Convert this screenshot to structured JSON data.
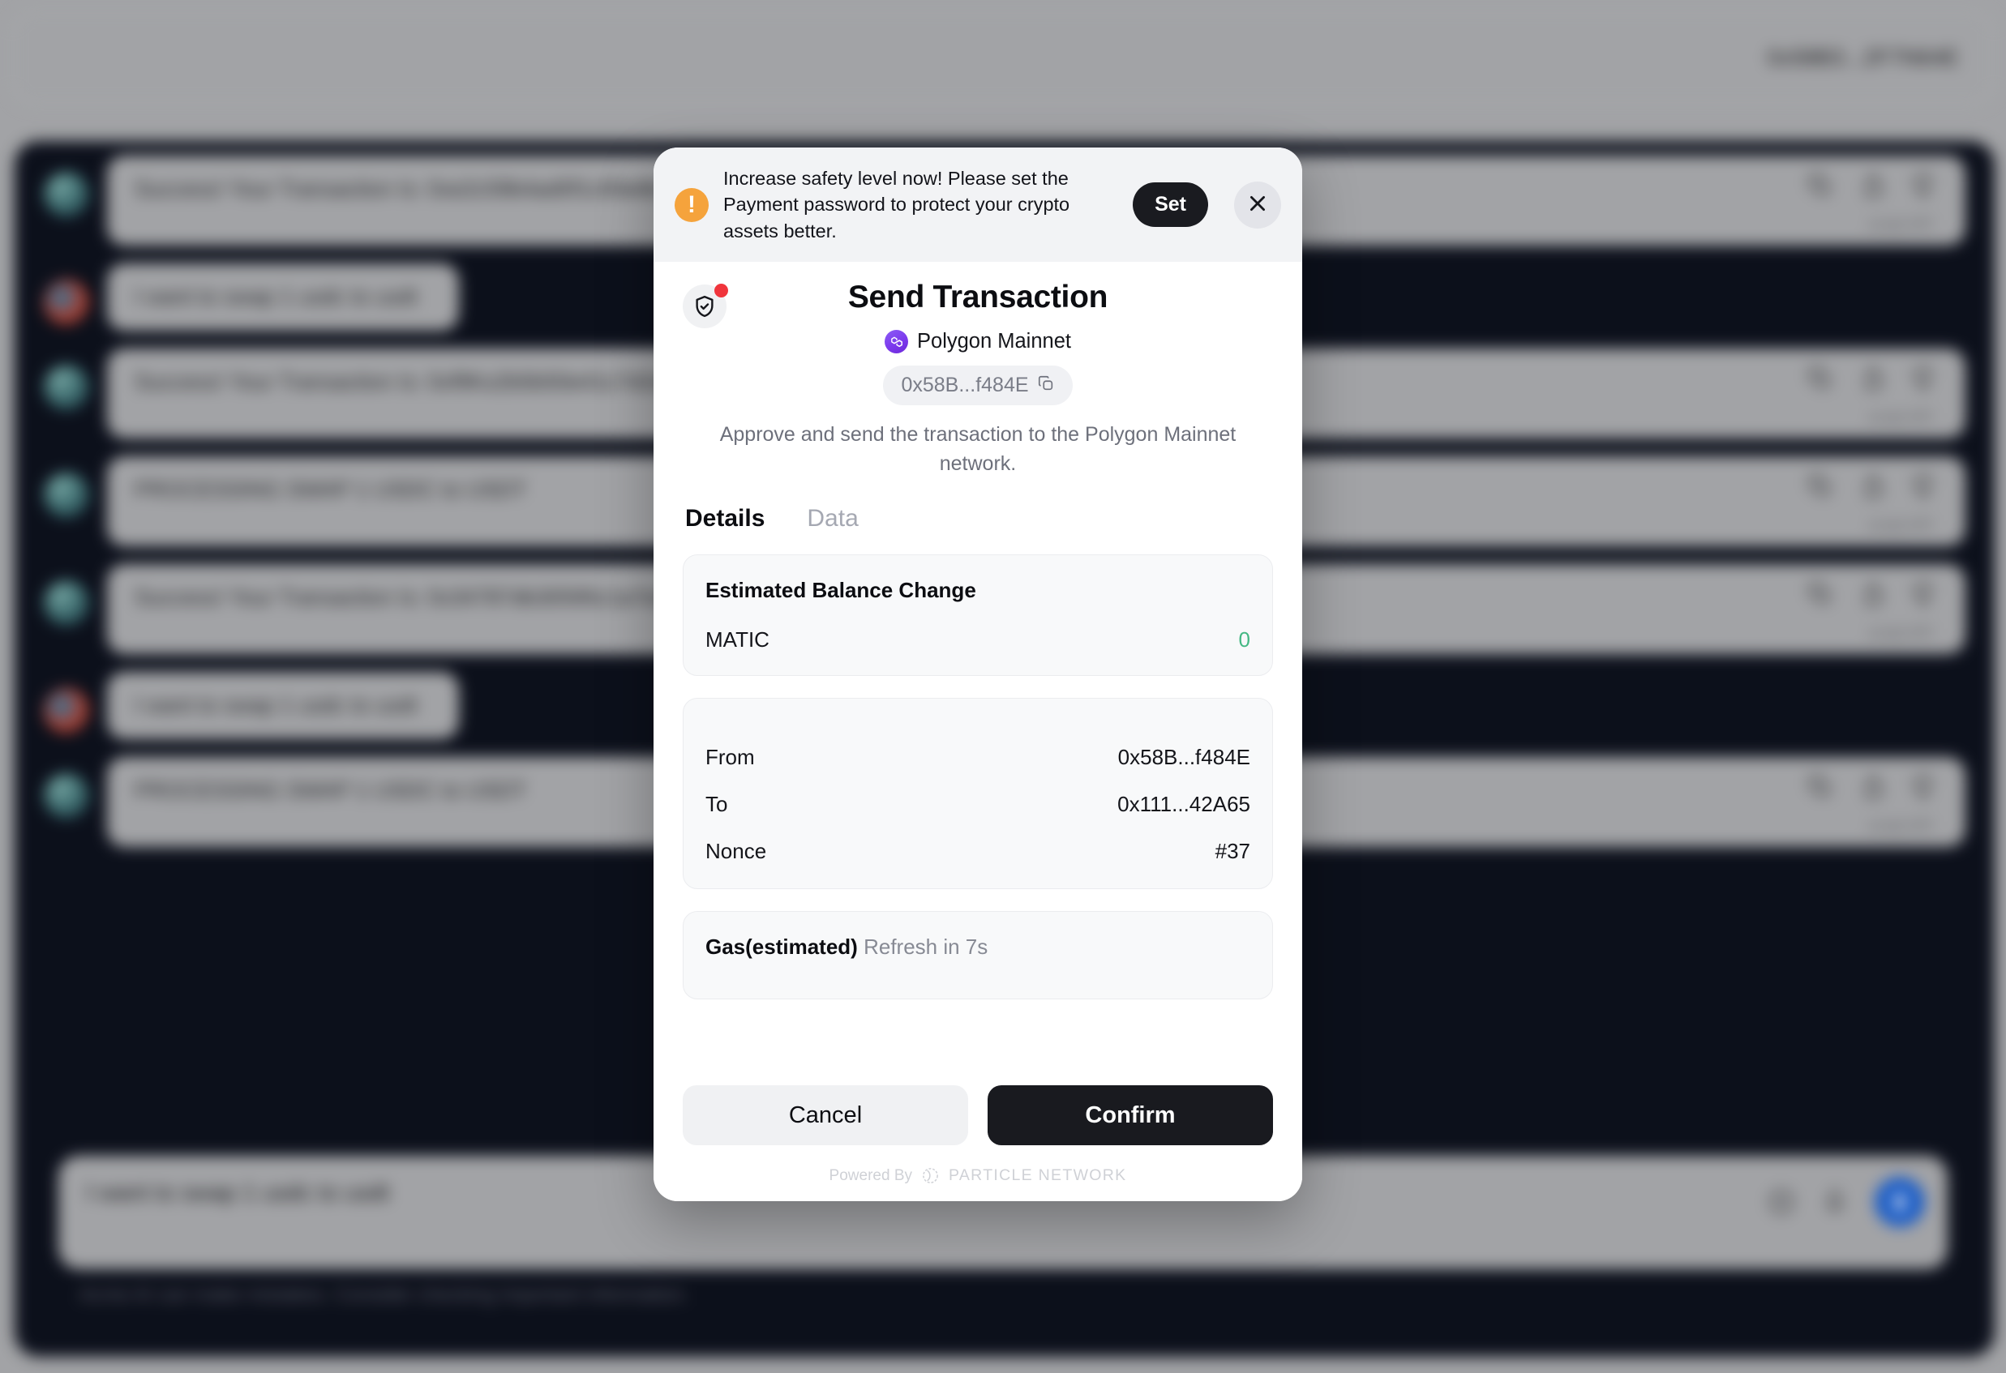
{
  "background": {
    "topbar": {
      "wallet_address": "0x58B3...2F7N64E"
    },
    "messages": [
      {
        "role": "assistant",
        "text": "Success! Your Transaction Is: 0xe2c59b4ad0f1c93e8b7a2d1f4c6e8a9b3d5f7102c4e6980b",
        "meta": "script API",
        "actions": [
          "copy-icon",
          "thumbs-up-icon",
          "thumbs-down-icon"
        ]
      },
      {
        "role": "user",
        "text": "I want to swap 1 usdc to usdt"
      },
      {
        "role": "assistant",
        "text": "Success! Your Transaction Is: 0xf9Ko2b5b50e41c7d2e8a6f3b9c1d4e7a2058b6c3d9e1f479",
        "meta": "script API",
        "actions": [
          "copy-icon",
          "thumbs-up-icon",
          "thumbs-down-icon"
        ]
      },
      {
        "role": "assistant",
        "text": "PROCESSING SWAP 1 USDC to USDT",
        "meta": "script API",
        "actions": [
          "copy-icon",
          "thumbs-up-icon",
          "thumbs-down-icon"
        ]
      },
      {
        "role": "assistant",
        "text": "Success! Your Transaction Is: 0x34787db30595c1a7e2f9b4c8d6e0a3f5172b9e4c6d8f0a32",
        "meta": "script API",
        "actions": [
          "copy-icon",
          "thumbs-up-icon",
          "thumbs-down-icon"
        ]
      },
      {
        "role": "user",
        "text": "I want to swap 1 usdc to usdt"
      },
      {
        "role": "assistant",
        "text": "PROCESSING SWAP 1 USDC to USDT",
        "meta": "script API",
        "actions": [
          "copy-icon",
          "thumbs-up-icon",
          "thumbs-down-icon"
        ]
      }
    ],
    "composer": {
      "value": "I want to swap 1 usdc to usdt",
      "icons": [
        "emoji-icon",
        "microphone-icon",
        "send-icon"
      ]
    },
    "disclaimer": "Acme AI can make mistakes. Consider checking important information."
  },
  "modal": {
    "warning_banner": {
      "message": "Increase safety level now! Please set the Payment password to protect your crypto assets better.",
      "set_label": "Set",
      "close_label": "×"
    },
    "header": {
      "title": "Send Transaction",
      "network": "Polygon Mainnet",
      "address": "0x58B...f484E",
      "description": "Approve and send the transaction to the Polygon Mainnet network."
    },
    "tabs": [
      {
        "label": "Details",
        "active": true
      },
      {
        "label": "Data",
        "active": false
      }
    ],
    "balance_card": {
      "title": "Estimated Balance Change",
      "rows": [
        {
          "key": "MATIC",
          "value": "0",
          "color": "#44b883"
        }
      ]
    },
    "tx_card": {
      "rows": [
        {
          "key": "From",
          "value": "0x58B...f484E"
        },
        {
          "key": "To",
          "value": "0x111...42A65"
        },
        {
          "key": "Nonce",
          "value": "#37"
        }
      ]
    },
    "gas_card": {
      "label": "Gas(estimated)",
      "refresh": "Refresh in 7s"
    },
    "footer": {
      "cancel_label": "Cancel",
      "confirm_label": "Confirm",
      "powered_by": "Powered By",
      "brand": "PARTICLE NETWORK"
    }
  },
  "colors": {
    "accent_dark": "#191a1f",
    "warning_orange": "#f5a33c",
    "success_green": "#44b883",
    "notification_red": "#f0353c",
    "polygon_purple": "#7c3aed",
    "send_blue": "#1e62d0"
  }
}
